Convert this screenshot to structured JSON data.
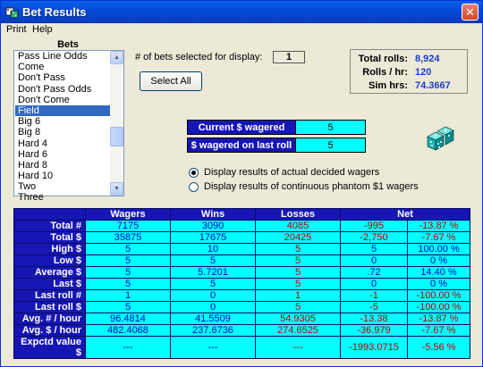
{
  "window": {
    "title": "Bet Results",
    "close_glyph": "✕"
  },
  "menu": {
    "items": [
      "Print",
      "Help"
    ]
  },
  "bets": {
    "label": "Bets",
    "items": [
      "Pass Line Odds",
      "Come",
      "Don't Pass",
      "Don't Pass Odds",
      "Don't Come",
      "Field",
      "Big 6",
      "Big 8",
      "Hard 4",
      "Hard 6",
      "Hard 8",
      "Hard 10",
      "Two",
      "Three"
    ],
    "selected": "Field"
  },
  "display": {
    "label": "# of bets selected for display:",
    "count": "1"
  },
  "select_all": {
    "label": "Select All"
  },
  "stats": {
    "total_rolls_label": "Total rolls:",
    "total_rolls": "8,924",
    "rolls_hr_label": "Rolls / hr:",
    "rolls_hr": "120",
    "sim_hrs_label": "Sim hrs:",
    "sim_hrs": "74.3667"
  },
  "wager": {
    "current_label": "Current $ wagered",
    "current_value": "5",
    "last_label": "$ wagered on last roll",
    "last_value": "5"
  },
  "radios": {
    "actual": "Display results of actual decided wagers",
    "phantom": "Display results of continuous phantom $1 wagers",
    "selected": "actual"
  },
  "table": {
    "headers": [
      "",
      "Wagers",
      "Wins",
      "Losses",
      "Net",
      ""
    ],
    "rows": [
      {
        "label": "Total #",
        "wagers": "7175",
        "wins": "3090",
        "losses": "4085",
        "net": "-995",
        "pct": "-13.87 %"
      },
      {
        "label": "Total $",
        "wagers": "35875",
        "wins": "17675",
        "losses": "20425",
        "net": "-2,750",
        "pct": "-7.67 %"
      },
      {
        "label": "High $",
        "wagers": "5",
        "wins": "10",
        "losses": "5",
        "net": "5",
        "pct": "100.00 %"
      },
      {
        "label": "Low $",
        "wagers": "5",
        "wins": "5",
        "losses": "5",
        "net": "0",
        "pct": "0 %"
      },
      {
        "label": "Average $",
        "wagers": "5",
        "wins": "5.7201",
        "losses": "5",
        "net": ".72",
        "pct": "14.40 %"
      },
      {
        "label": "Last $",
        "wagers": "5",
        "wins": "5",
        "losses": "5",
        "net": "0",
        "pct": "0 %"
      },
      {
        "label": "Last roll #",
        "wagers": "1",
        "wins": "0",
        "losses": "1",
        "net": "-1",
        "pct": "-100.00 %"
      },
      {
        "label": "Last roll $",
        "wagers": "5",
        "wins": "0",
        "losses": "5",
        "net": "-5",
        "pct": "-100.00 %"
      },
      {
        "label": "Avg. # / hour",
        "wagers": "96.4814",
        "wins": "41.5509",
        "losses": "54.9305",
        "net": "-13.38",
        "pct": "-13.87 %"
      },
      {
        "label": "Avg. $ / hour",
        "wagers": "482.4068",
        "wins": "237.6736",
        "losses": "274.6525",
        "net": "-36.979",
        "pct": "-7.67 %"
      },
      {
        "label": "Expctd value $",
        "wagers": "---",
        "wins": "---",
        "losses": "---",
        "net": "-1993.0715",
        "pct": "-5.56 %"
      }
    ]
  },
  "colors": {
    "header_blue": "#1616b5",
    "cell_cyan": "#00ffff",
    "negative": "#c00000",
    "positive": "#0000c0"
  }
}
